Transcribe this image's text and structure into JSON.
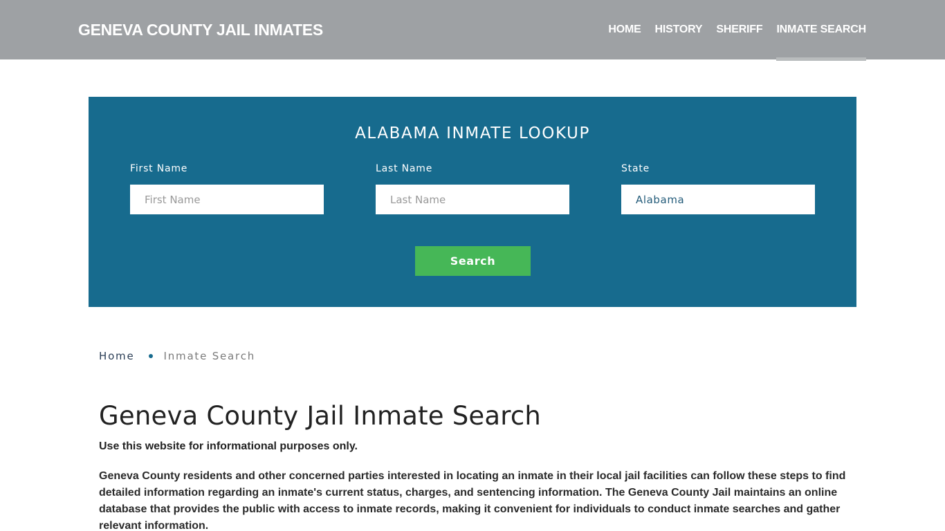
{
  "header": {
    "brand": "GENEVA COUNTY JAIL INMATES",
    "nav": [
      {
        "label": "HOME",
        "active": false
      },
      {
        "label": "HISTORY",
        "active": false
      },
      {
        "label": "SHERIFF",
        "active": false
      },
      {
        "label": "INMATE SEARCH",
        "active": true
      }
    ]
  },
  "lookup": {
    "title": "ALABAMA INMATE LOOKUP",
    "first_name": {
      "label": "First Name",
      "placeholder": "First Name",
      "value": ""
    },
    "last_name": {
      "label": "Last Name",
      "placeholder": "Last Name",
      "value": ""
    },
    "state": {
      "label": "State",
      "value": "Alabama"
    },
    "search_label": "Search"
  },
  "breadcrumb": {
    "home": "Home",
    "current": "Inmate Search"
  },
  "main": {
    "title": "Geneva County Jail Inmate Search",
    "disclaimer": "Use this website for informational purposes only.",
    "intro": "Geneva County residents and other concerned parties interested in locating an inmate in their local jail facilities can follow these steps to find detailed information regarding an inmate's current status, charges, and sentencing information. The Geneva County Jail maintains an online database that provides the public with access to inmate records, making it convenient for individuals to conduct inmate searches and gather relevant information."
  },
  "colors": {
    "header_bg": "#9ea1a4",
    "lookup_bg": "#176b8e",
    "search_button": "#46b757"
  }
}
